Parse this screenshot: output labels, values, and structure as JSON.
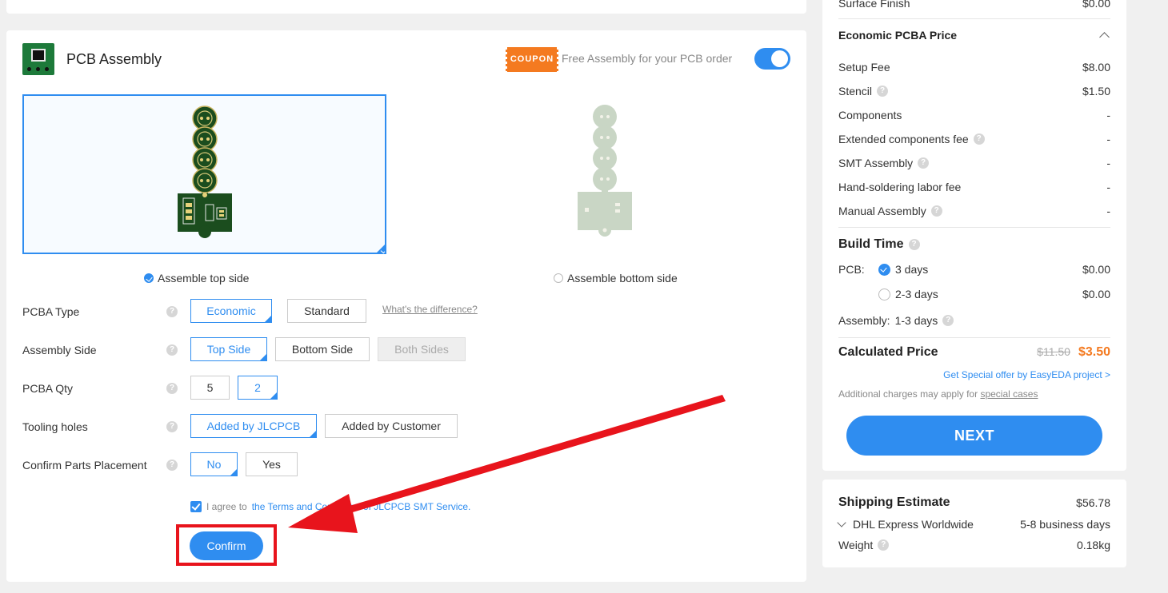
{
  "assembly": {
    "title": "PCB Assembly",
    "coupon_label": "COUPON",
    "free_text": "Free Assembly for your PCB order",
    "assemble_top": "Assemble top side",
    "assemble_bottom": "Assemble bottom side",
    "options": {
      "pcba_type": {
        "label": "PCBA Type",
        "choices": [
          "Economic",
          "Standard"
        ],
        "selected": "Economic",
        "diff_link": "What's the difference?"
      },
      "assembly_side": {
        "label": "Assembly Side",
        "choices": [
          "Top Side",
          "Bottom Side",
          "Both Sides"
        ],
        "selected": "Top Side"
      },
      "pcba_qty": {
        "label": "PCBA Qty",
        "choices": [
          "5",
          "2"
        ],
        "selected": "2"
      },
      "tooling_holes": {
        "label": "Tooling holes",
        "choices": [
          "Added by JLCPCB",
          "Added by Customer"
        ],
        "selected": "Added by JLCPCB"
      },
      "confirm_parts": {
        "label": "Confirm Parts Placement",
        "choices": [
          "No",
          "Yes"
        ],
        "selected": "No"
      }
    },
    "agree_prefix": "I agree to",
    "agree_link": "the Terms and Conditions of JLCPCB SMT Service.",
    "confirm_label": "Confirm",
    "help_glyph": "?"
  },
  "price": {
    "surface_finish": {
      "label": "Surface Finish",
      "value": "$0.00"
    },
    "section_title": "Economic PCBA Price",
    "rows": [
      {
        "label": "Setup Fee",
        "value": "$8.00",
        "help": false
      },
      {
        "label": "Stencil",
        "value": "$1.50",
        "help": true
      },
      {
        "label": "Components",
        "value": "-",
        "help": false
      },
      {
        "label": "Extended components fee",
        "value": "-",
        "help": true
      },
      {
        "label": "SMT Assembly",
        "value": "-",
        "help": true
      },
      {
        "label": "Hand-soldering labor fee",
        "value": "-",
        "help": false
      },
      {
        "label": "Manual Assembly",
        "value": "-",
        "help": true
      }
    ],
    "build_time_title": "Build Time",
    "pcb_label": "PCB:",
    "pcb_options": [
      {
        "label": "3 days",
        "value": "$0.00",
        "selected": true
      },
      {
        "label": "2-3 days",
        "value": "$0.00",
        "selected": false
      }
    ],
    "assembly_time_label": "Assembly:",
    "assembly_time_value": "1-3 days",
    "calculated_label": "Calculated Price",
    "old_price": "$11.50",
    "new_price": "$3.50",
    "special_offer": "Get Special offer by EasyEDA project >",
    "additional_prefix": "Additional charges may apply for",
    "additional_link": "special cases",
    "next_label": "NEXT"
  },
  "shipping": {
    "title": "Shipping Estimate",
    "value": "$56.78",
    "method": "DHL Express Worldwide",
    "method_time": "5-8 business days",
    "weight_label": "Weight",
    "weight_value": "0.18kg"
  },
  "colors": {
    "accent": "#2f8df0",
    "highlight": "#e8141c",
    "coupon": "#f47a20",
    "pcb_green": "#1b4d1e"
  }
}
